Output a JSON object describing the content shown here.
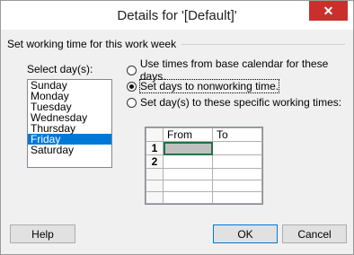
{
  "window": {
    "title": "Details for '[Default]'",
    "close_label": "✕"
  },
  "group": {
    "label": "Set working time for this work week"
  },
  "days": {
    "label": "Select day(s):",
    "items": [
      "Sunday",
      "Monday",
      "Tuesday",
      "Wednesday",
      "Thursday",
      "Friday",
      "Saturday"
    ],
    "selected": "Friday"
  },
  "options": [
    {
      "label": "Use times from base calendar for these days.",
      "checked": false
    },
    {
      "label": "Set days to nonworking time.",
      "checked": true
    },
    {
      "label": "Set day(s) to these specific working times:",
      "checked": false
    }
  ],
  "grid": {
    "headers": [
      "From",
      "To"
    ],
    "rows": [
      "1",
      "2",
      "",
      "",
      ""
    ]
  },
  "buttons": {
    "help": "Help",
    "ok": "OK",
    "cancel": "Cancel"
  }
}
